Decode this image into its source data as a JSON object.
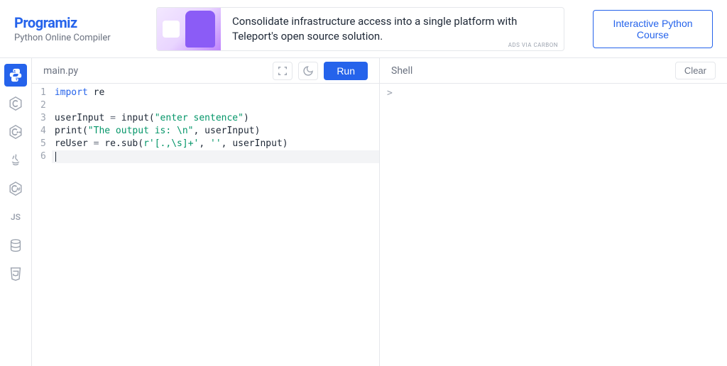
{
  "brand": {
    "name": "Programiz",
    "subtitle": "Python Online Compiler"
  },
  "ad": {
    "text": "Consolidate infrastructure access into a single platform with Teleport's open source solution.",
    "credit": "ADS VIA CARBON"
  },
  "cta": {
    "course_button": "Interactive Python Course"
  },
  "sidebar": {
    "items": [
      {
        "name": "python",
        "active": true
      },
      {
        "name": "c",
        "active": false
      },
      {
        "name": "cpp",
        "active": false
      },
      {
        "name": "java",
        "active": false
      },
      {
        "name": "csharp",
        "active": false
      },
      {
        "name": "js",
        "active": false
      },
      {
        "name": "sql",
        "active": false
      },
      {
        "name": "html",
        "active": false
      }
    ]
  },
  "editor": {
    "filename": "main.py",
    "run_label": "Run",
    "line_numbers": [
      "1",
      "2",
      "3",
      "4",
      "5",
      "6"
    ],
    "code": [
      {
        "tokens": [
          {
            "t": "import",
            "c": "keyword"
          },
          {
            "t": " re",
            "c": "text"
          }
        ]
      },
      {
        "tokens": []
      },
      {
        "tokens": [
          {
            "t": "userInput ",
            "c": "text"
          },
          {
            "t": "=",
            "c": "op"
          },
          {
            "t": " input(",
            "c": "text"
          },
          {
            "t": "\"enter sentence\"",
            "c": "string"
          },
          {
            "t": ")",
            "c": "text"
          }
        ]
      },
      {
        "tokens": [
          {
            "t": "print",
            "c": "text"
          },
          {
            "t": "(",
            "c": "text"
          },
          {
            "t": "\"The output is: \\n\"",
            "c": "string"
          },
          {
            "t": ", userInput)",
            "c": "text"
          }
        ]
      },
      {
        "tokens": [
          {
            "t": "reUser ",
            "c": "text"
          },
          {
            "t": "=",
            "c": "op"
          },
          {
            "t": " re.sub(",
            "c": "text"
          },
          {
            "t": "r'[.,\\s]+'",
            "c": "string"
          },
          {
            "t": ", ",
            "c": "text"
          },
          {
            "t": "''",
            "c": "string"
          },
          {
            "t": ", userInput)",
            "c": "text"
          }
        ]
      },
      {
        "tokens": [],
        "active": true,
        "cursor": true
      }
    ]
  },
  "shell": {
    "title": "Shell",
    "clear_label": "Clear",
    "prompt": ">"
  },
  "colors": {
    "primary": "#2563eb",
    "string": "#059669",
    "muted": "#9ca3af"
  }
}
